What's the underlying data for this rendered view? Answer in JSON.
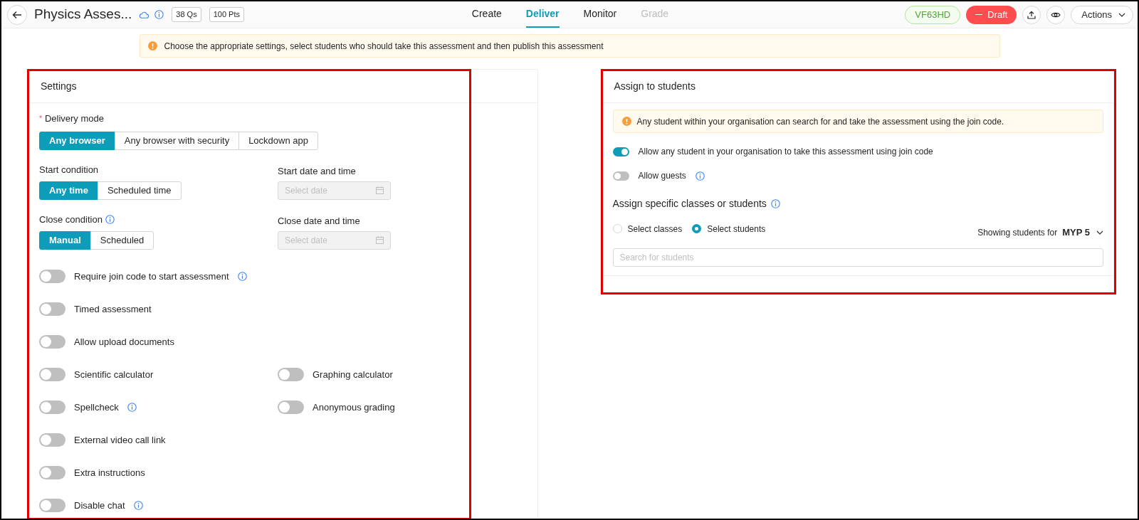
{
  "header": {
    "title": "Physics Asses...",
    "badges": [
      "38 Qs",
      "100 Pts"
    ],
    "tabs": [
      {
        "label": "Create",
        "selected": false,
        "disabled": false
      },
      {
        "label": "Deliver",
        "selected": true,
        "disabled": false
      },
      {
        "label": "Monitor",
        "selected": false,
        "disabled": false
      },
      {
        "label": "Grade",
        "selected": false,
        "disabled": true
      }
    ],
    "code": "VF63HD",
    "status_button": "Draft",
    "actions_button": "Actions"
  },
  "banner": "Choose the appropriate settings, select students who should take this assessment and then publish this assessment",
  "settings": {
    "title": "Settings",
    "highlighted": true,
    "delivery_mode": {
      "label": "Delivery mode",
      "required_mark": "*",
      "options": [
        {
          "label": "Any browser",
          "selected": true
        },
        {
          "label": "Any browser with security",
          "selected": false
        },
        {
          "label": "Lockdown app",
          "selected": false
        }
      ]
    },
    "start_condition": {
      "label": "Start condition",
      "info": false,
      "options": [
        {
          "label": "Any time",
          "selected": true
        },
        {
          "label": "Scheduled time",
          "selected": false
        }
      ]
    },
    "start_datetime": {
      "label": "Start date and time",
      "placeholder": "Select date",
      "disabled": true
    },
    "close_condition": {
      "label": "Close condition",
      "info": true,
      "options": [
        {
          "label": "Manual",
          "selected": true
        },
        {
          "label": "Scheduled",
          "selected": false
        }
      ]
    },
    "close_datetime": {
      "label": "Close date and time",
      "placeholder": "Select date",
      "disabled": true
    },
    "toggle_rows": [
      {
        "items": [
          {
            "label": "Require join code to start assessment",
            "on": false,
            "info": true
          }
        ]
      },
      {
        "items": [
          {
            "label": "Timed assessment",
            "on": false,
            "info": false
          }
        ]
      },
      {
        "items": [
          {
            "label": "Allow upload documents",
            "on": false,
            "info": false
          }
        ]
      },
      {
        "items": [
          {
            "label": "Scientific calculator",
            "on": false,
            "info": false
          },
          {
            "label": "Graphing calculator",
            "on": false,
            "info": false
          }
        ]
      },
      {
        "items": [
          {
            "label": "Spellcheck",
            "on": false,
            "info": true
          },
          {
            "label": "Anonymous grading",
            "on": false,
            "info": false
          }
        ]
      },
      {
        "items": [
          {
            "label": "External video call link",
            "on": false,
            "info": false
          }
        ]
      },
      {
        "items": [
          {
            "label": "Extra instructions",
            "on": false,
            "info": false
          }
        ]
      },
      {
        "items": [
          {
            "label": "Disable chat",
            "on": false,
            "info": true
          }
        ]
      }
    ]
  },
  "assign": {
    "title": "Assign to students",
    "highlighted": true,
    "notice": "Any student within your organisation can search for and take the assessment using the join code.",
    "toggles": [
      {
        "label": "Allow any student in your organisation to take this assessment using join code",
        "on": true,
        "info": false
      },
      {
        "label": "Allow guests",
        "on": false,
        "info": true
      }
    ],
    "section_title": "Assign specific classes or students",
    "section_info": true,
    "radios": [
      {
        "label": "Select classes",
        "selected": false
      },
      {
        "label": "Select students",
        "selected": true
      }
    ],
    "showing_label": "Showing students for",
    "showing_value": "MYP 5",
    "search_placeholder": "Search for students"
  }
}
